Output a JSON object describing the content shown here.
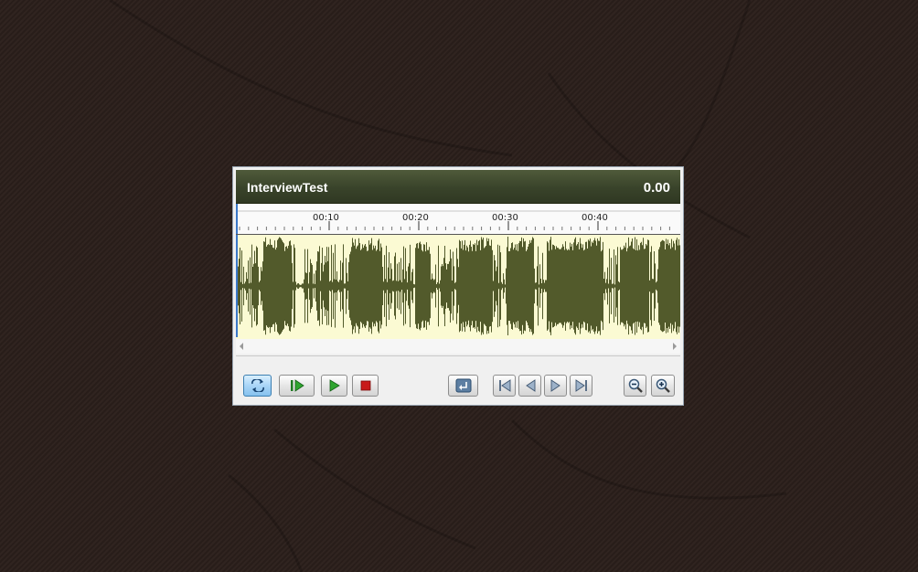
{
  "window": {
    "title": "InterviewTest",
    "time_display": "0.00"
  },
  "timeline": {
    "labels": [
      "00:10",
      "00:20",
      "00:30",
      "00:40"
    ]
  },
  "toolbar": {
    "buttons": [
      {
        "id": "loop",
        "icon": "loop-icon",
        "active": true
      },
      {
        "id": "play-selection",
        "icon": "play-selection-icon"
      },
      {
        "id": "play",
        "icon": "play-icon"
      },
      {
        "id": "stop",
        "icon": "stop-icon"
      },
      {
        "id": "return",
        "icon": "return-icon"
      },
      {
        "id": "go-to-start",
        "icon": "skip-start-icon"
      },
      {
        "id": "previous",
        "icon": "step-back-icon"
      },
      {
        "id": "next",
        "icon": "step-forward-icon"
      },
      {
        "id": "go-to-end",
        "icon": "skip-end-icon"
      },
      {
        "id": "zoom-out",
        "icon": "zoom-out-icon"
      },
      {
        "id": "zoom-in",
        "icon": "zoom-in-icon"
      }
    ]
  },
  "colors": {
    "title_bar": "#39432a",
    "waveform": "#525a2b",
    "waveform_background": "#fbfad3",
    "background": "#2b1f1b"
  }
}
